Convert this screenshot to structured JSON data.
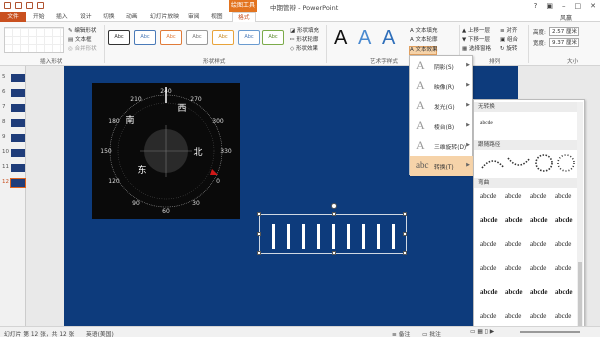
{
  "window": {
    "title": "中期管辩 - PowerPoint",
    "context_tool": "绘图工具",
    "user": "风赢"
  },
  "tabs": [
    {
      "label": "文件"
    },
    {
      "label": "开始"
    },
    {
      "label": "插入"
    },
    {
      "label": "设计"
    },
    {
      "label": "切换"
    },
    {
      "label": "动画"
    },
    {
      "label": "幻灯片放映"
    },
    {
      "label": "审阅"
    },
    {
      "label": "视图"
    },
    {
      "label": "格式"
    }
  ],
  "ribbon": {
    "insert_shapes": {
      "label": "插入形状",
      "edit_shape": "编辑形状",
      "text_box": "文本框",
      "merge_shapes": "合并形状"
    },
    "shape_styles": {
      "label": "形状样式",
      "style_sample": "Abc",
      "fill": "形状填充",
      "outline": "形状轮廓",
      "effects": "形状效果"
    },
    "wordart_styles": {
      "label": "艺术字样式",
      "text_fill": "文本填充",
      "text_outline": "文本轮廓",
      "text_effects": "文本效果",
      "sample": "A"
    },
    "arrange": {
      "label": "排列",
      "bring_forward": "上移一层",
      "send_backward": "下移一层",
      "selection_pane": "选择窗格",
      "align": "对齐",
      "group": "组合",
      "rotate": "旋转"
    },
    "size": {
      "label": "大小",
      "height": "2.57 厘米",
      "width": "9.37 厘米",
      "height_label": "高度:",
      "width_label": "宽度:"
    }
  },
  "slides": [
    {
      "num": "5"
    },
    {
      "num": "6"
    },
    {
      "num": "7"
    },
    {
      "num": "8"
    },
    {
      "num": "9"
    },
    {
      "num": "10"
    },
    {
      "num": "11"
    },
    {
      "num": "12"
    }
  ],
  "compass": {
    "directions": [
      "南",
      "西",
      "北",
      "东"
    ],
    "degree_labels": [
      "240",
      "270",
      "300",
      "330",
      "0",
      "30",
      "60",
      "90",
      "120",
      "150",
      "180",
      "210"
    ]
  },
  "text_effects_menu": {
    "items": [
      {
        "label": "阴影(S)",
        "icon": "A"
      },
      {
        "label": "映像(R)",
        "icon": "A"
      },
      {
        "label": "发光(G)",
        "icon": "A"
      },
      {
        "label": "棱台(B)",
        "icon": "A"
      },
      {
        "label": "三维旋转(D)",
        "icon": "A"
      },
      {
        "label": "转换(T)",
        "icon": "abc"
      }
    ]
  },
  "transform_gallery": {
    "no_transform": "无转换",
    "no_transform_sample": "abcde",
    "follow_path": "跟随路径",
    "warp": "弯曲",
    "warp_sample": "abcde"
  },
  "status": {
    "slide_info": "幻灯片 第 12 张，共 12 张",
    "language": "英语(美国)",
    "notes": "备注",
    "comments": "批注"
  },
  "colors": {
    "accent": "#c9501f",
    "slide_bg": "#0d3b7c",
    "highlight": "#f6d3a9"
  }
}
